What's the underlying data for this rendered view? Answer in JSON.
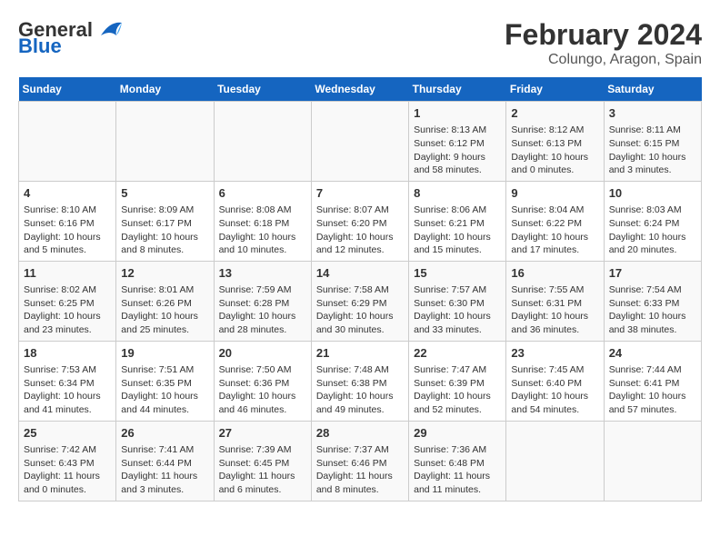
{
  "header": {
    "logo_general": "General",
    "logo_blue": "Blue",
    "title": "February 2024",
    "subtitle": "Colungo, Aragon, Spain"
  },
  "calendar": {
    "days_of_week": [
      "Sunday",
      "Monday",
      "Tuesday",
      "Wednesday",
      "Thursday",
      "Friday",
      "Saturday"
    ],
    "weeks": [
      [
        {
          "day": "",
          "content": ""
        },
        {
          "day": "",
          "content": ""
        },
        {
          "day": "",
          "content": ""
        },
        {
          "day": "",
          "content": ""
        },
        {
          "day": "1",
          "content": "Sunrise: 8:13 AM\nSunset: 6:12 PM\nDaylight: 9 hours and 58 minutes."
        },
        {
          "day": "2",
          "content": "Sunrise: 8:12 AM\nSunset: 6:13 PM\nDaylight: 10 hours and 0 minutes."
        },
        {
          "day": "3",
          "content": "Sunrise: 8:11 AM\nSunset: 6:15 PM\nDaylight: 10 hours and 3 minutes."
        }
      ],
      [
        {
          "day": "4",
          "content": "Sunrise: 8:10 AM\nSunset: 6:16 PM\nDaylight: 10 hours and 5 minutes."
        },
        {
          "day": "5",
          "content": "Sunrise: 8:09 AM\nSunset: 6:17 PM\nDaylight: 10 hours and 8 minutes."
        },
        {
          "day": "6",
          "content": "Sunrise: 8:08 AM\nSunset: 6:18 PM\nDaylight: 10 hours and 10 minutes."
        },
        {
          "day": "7",
          "content": "Sunrise: 8:07 AM\nSunset: 6:20 PM\nDaylight: 10 hours and 12 minutes."
        },
        {
          "day": "8",
          "content": "Sunrise: 8:06 AM\nSunset: 6:21 PM\nDaylight: 10 hours and 15 minutes."
        },
        {
          "day": "9",
          "content": "Sunrise: 8:04 AM\nSunset: 6:22 PM\nDaylight: 10 hours and 17 minutes."
        },
        {
          "day": "10",
          "content": "Sunrise: 8:03 AM\nSunset: 6:24 PM\nDaylight: 10 hours and 20 minutes."
        }
      ],
      [
        {
          "day": "11",
          "content": "Sunrise: 8:02 AM\nSunset: 6:25 PM\nDaylight: 10 hours and 23 minutes."
        },
        {
          "day": "12",
          "content": "Sunrise: 8:01 AM\nSunset: 6:26 PM\nDaylight: 10 hours and 25 minutes."
        },
        {
          "day": "13",
          "content": "Sunrise: 7:59 AM\nSunset: 6:28 PM\nDaylight: 10 hours and 28 minutes."
        },
        {
          "day": "14",
          "content": "Sunrise: 7:58 AM\nSunset: 6:29 PM\nDaylight: 10 hours and 30 minutes."
        },
        {
          "day": "15",
          "content": "Sunrise: 7:57 AM\nSunset: 6:30 PM\nDaylight: 10 hours and 33 minutes."
        },
        {
          "day": "16",
          "content": "Sunrise: 7:55 AM\nSunset: 6:31 PM\nDaylight: 10 hours and 36 minutes."
        },
        {
          "day": "17",
          "content": "Sunrise: 7:54 AM\nSunset: 6:33 PM\nDaylight: 10 hours and 38 minutes."
        }
      ],
      [
        {
          "day": "18",
          "content": "Sunrise: 7:53 AM\nSunset: 6:34 PM\nDaylight: 10 hours and 41 minutes."
        },
        {
          "day": "19",
          "content": "Sunrise: 7:51 AM\nSunset: 6:35 PM\nDaylight: 10 hours and 44 minutes."
        },
        {
          "day": "20",
          "content": "Sunrise: 7:50 AM\nSunset: 6:36 PM\nDaylight: 10 hours and 46 minutes."
        },
        {
          "day": "21",
          "content": "Sunrise: 7:48 AM\nSunset: 6:38 PM\nDaylight: 10 hours and 49 minutes."
        },
        {
          "day": "22",
          "content": "Sunrise: 7:47 AM\nSunset: 6:39 PM\nDaylight: 10 hours and 52 minutes."
        },
        {
          "day": "23",
          "content": "Sunrise: 7:45 AM\nSunset: 6:40 PM\nDaylight: 10 hours and 54 minutes."
        },
        {
          "day": "24",
          "content": "Sunrise: 7:44 AM\nSunset: 6:41 PM\nDaylight: 10 hours and 57 minutes."
        }
      ],
      [
        {
          "day": "25",
          "content": "Sunrise: 7:42 AM\nSunset: 6:43 PM\nDaylight: 11 hours and 0 minutes."
        },
        {
          "day": "26",
          "content": "Sunrise: 7:41 AM\nSunset: 6:44 PM\nDaylight: 11 hours and 3 minutes."
        },
        {
          "day": "27",
          "content": "Sunrise: 7:39 AM\nSunset: 6:45 PM\nDaylight: 11 hours and 6 minutes."
        },
        {
          "day": "28",
          "content": "Sunrise: 7:37 AM\nSunset: 6:46 PM\nDaylight: 11 hours and 8 minutes."
        },
        {
          "day": "29",
          "content": "Sunrise: 7:36 AM\nSunset: 6:48 PM\nDaylight: 11 hours and 11 minutes."
        },
        {
          "day": "",
          "content": ""
        },
        {
          "day": "",
          "content": ""
        }
      ]
    ]
  }
}
